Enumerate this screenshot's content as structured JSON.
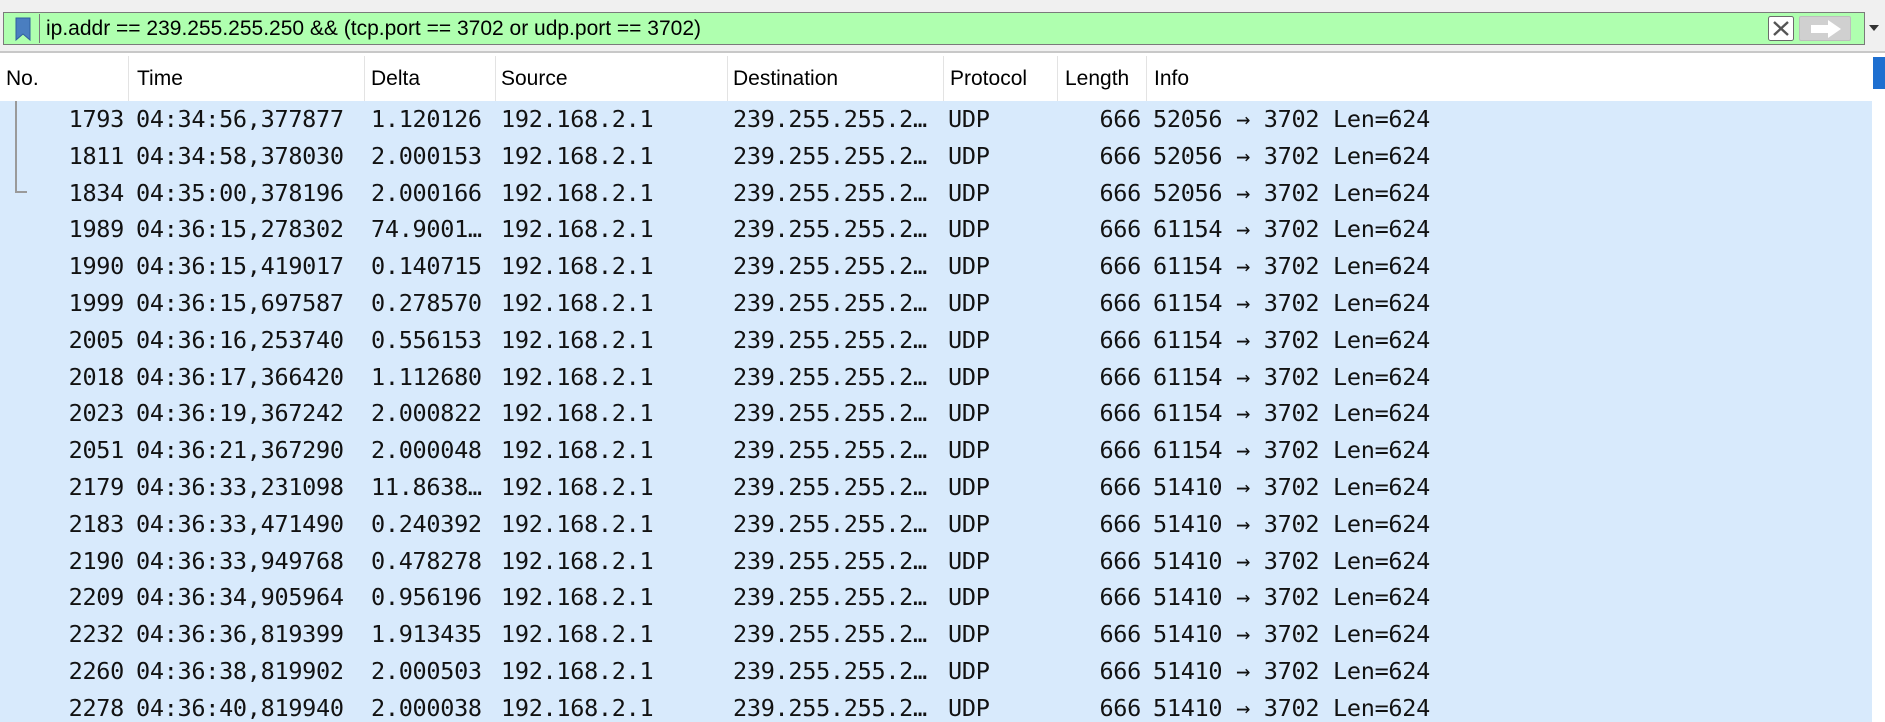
{
  "filter": {
    "expression": "ip.addr == 239.255.255.250 && (tcp.port == 3702 or udp.port == 3702)",
    "bookmark_icon": "bookmark-icon",
    "clear_icon": "close-icon",
    "apply_icon": "arrow-right-icon",
    "dropdown_icon": "chevron-down-icon",
    "bg_color": "#afffaf"
  },
  "columns": {
    "no": "No.",
    "time": "Time",
    "delta": "Delta",
    "source": "Source",
    "destination": "Destination",
    "protocol": "Protocol",
    "length": "Length",
    "info": "Info"
  },
  "row_bg_color": "#d8eafc",
  "rows": [
    {
      "no": "1793",
      "time": "04:34:56,377877",
      "delta": "1.120126",
      "source": "192.168.2.1",
      "destination": "239.255.255.2…",
      "protocol": "UDP",
      "length": "666",
      "info": "52056 → 3702 Len=624"
    },
    {
      "no": "1811",
      "time": "04:34:58,378030",
      "delta": "2.000153",
      "source": "192.168.2.1",
      "destination": "239.255.255.2…",
      "protocol": "UDP",
      "length": "666",
      "info": "52056 → 3702 Len=624"
    },
    {
      "no": "1834",
      "time": "04:35:00,378196",
      "delta": "2.000166",
      "source": "192.168.2.1",
      "destination": "239.255.255.2…",
      "protocol": "UDP",
      "length": "666",
      "info": "52056 → 3702 Len=624"
    },
    {
      "no": "1989",
      "time": "04:36:15,278302",
      "delta": "74.9001…",
      "source": "192.168.2.1",
      "destination": "239.255.255.2…",
      "protocol": "UDP",
      "length": "666",
      "info": "61154 → 3702 Len=624"
    },
    {
      "no": "1990",
      "time": "04:36:15,419017",
      "delta": "0.140715",
      "source": "192.168.2.1",
      "destination": "239.255.255.2…",
      "protocol": "UDP",
      "length": "666",
      "info": "61154 → 3702 Len=624"
    },
    {
      "no": "1999",
      "time": "04:36:15,697587",
      "delta": "0.278570",
      "source": "192.168.2.1",
      "destination": "239.255.255.2…",
      "protocol": "UDP",
      "length": "666",
      "info": "61154 → 3702 Len=624"
    },
    {
      "no": "2005",
      "time": "04:36:16,253740",
      "delta": "0.556153",
      "source": "192.168.2.1",
      "destination": "239.255.255.2…",
      "protocol": "UDP",
      "length": "666",
      "info": "61154 → 3702 Len=624"
    },
    {
      "no": "2018",
      "time": "04:36:17,366420",
      "delta": "1.112680",
      "source": "192.168.2.1",
      "destination": "239.255.255.2…",
      "protocol": "UDP",
      "length": "666",
      "info": "61154 → 3702 Len=624"
    },
    {
      "no": "2023",
      "time": "04:36:19,367242",
      "delta": "2.000822",
      "source": "192.168.2.1",
      "destination": "239.255.255.2…",
      "protocol": "UDP",
      "length": "666",
      "info": "61154 → 3702 Len=624"
    },
    {
      "no": "2051",
      "time": "04:36:21,367290",
      "delta": "2.000048",
      "source": "192.168.2.1",
      "destination": "239.255.255.2…",
      "protocol": "UDP",
      "length": "666",
      "info": "61154 → 3702 Len=624"
    },
    {
      "no": "2179",
      "time": "04:36:33,231098",
      "delta": "11.8638…",
      "source": "192.168.2.1",
      "destination": "239.255.255.2…",
      "protocol": "UDP",
      "length": "666",
      "info": "51410 → 3702 Len=624"
    },
    {
      "no": "2183",
      "time": "04:36:33,471490",
      "delta": "0.240392",
      "source": "192.168.2.1",
      "destination": "239.255.255.2…",
      "protocol": "UDP",
      "length": "666",
      "info": "51410 → 3702 Len=624"
    },
    {
      "no": "2190",
      "time": "04:36:33,949768",
      "delta": "0.478278",
      "source": "192.168.2.1",
      "destination": "239.255.255.2…",
      "protocol": "UDP",
      "length": "666",
      "info": "51410 → 3702 Len=624"
    },
    {
      "no": "2209",
      "time": "04:36:34,905964",
      "delta": "0.956196",
      "source": "192.168.2.1",
      "destination": "239.255.255.2…",
      "protocol": "UDP",
      "length": "666",
      "info": "51410 → 3702 Len=624"
    },
    {
      "no": "2232",
      "time": "04:36:36,819399",
      "delta": "1.913435",
      "source": "192.168.2.1",
      "destination": "239.255.255.2…",
      "protocol": "UDP",
      "length": "666",
      "info": "51410 → 3702 Len=624"
    },
    {
      "no": "2260",
      "time": "04:36:38,819902",
      "delta": "2.000503",
      "source": "192.168.2.1",
      "destination": "239.255.255.2…",
      "protocol": "UDP",
      "length": "666",
      "info": "51410 → 3702 Len=624"
    },
    {
      "no": "2278",
      "time": "04:36:40,819940",
      "delta": "2.000038",
      "source": "192.168.2.1",
      "destination": "239.255.255.2…",
      "protocol": "UDP",
      "length": "666",
      "info": "51410 → 3702 Len=624"
    }
  ]
}
